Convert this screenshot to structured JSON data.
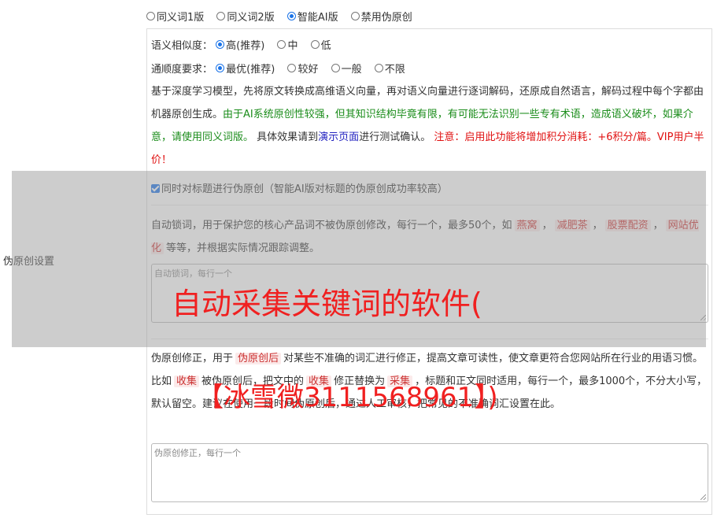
{
  "modes": [
    {
      "label": "同义词1版",
      "selected": false
    },
    {
      "label": "同义词2版",
      "selected": false
    },
    {
      "label": "智能AI版",
      "selected": true
    },
    {
      "label": "禁用伪原创",
      "selected": false
    }
  ],
  "similarity": {
    "label": "语义相似度：",
    "options": [
      "高(推荐)",
      "中",
      "低"
    ]
  },
  "fluency": {
    "label": "通顺度要求：",
    "options": [
      "最优(推荐)",
      "较好",
      "一般",
      "不限"
    ]
  },
  "desc": {
    "p1": "基于深度学习模型，先将原文转换成高维语义向量，再对语义向量进行逐词解码，还原成自然语言，解码过程中每个字都由机器原创生成。",
    "p2_green": "由于AI系统原创性较强，但其知识结构毕竟有限，有可能无法识别一些专有术语，造成语义破坏，如果介意，请使用同义词版。",
    "p3a": "具体效果请到",
    "p3_link": "演示页面",
    "p3b": "进行测试确认。",
    "p4_red": "注意：启用此功能将增加积分消耗：+6积分/篇。VIP用户半价！"
  },
  "section_label": "伪原创设置",
  "title_check": "同时对标题进行伪原创（智能AI版对标题的伪原创成功率较高）",
  "lock": {
    "text1": "自动锁词，用于保护您的核心产品词不被伪原创修改，每行一个，最多50个，如",
    "chips": [
      "燕窝",
      "减肥茶",
      "股票配资",
      "网站优化"
    ],
    "sep": "，",
    "text2": "等等，并根据实际情况跟踪调整。",
    "placeholder": "自动锁词，每行一个"
  },
  "correct": {
    "text1": "伪原创修正，用于",
    "chip": "伪原创后",
    "text2": "对某些不准确的词汇进行修正，提高文章可读性，使文章更符合您网站所在行业的用语习惯。比如",
    "chip2": "收集",
    "text3": "被伪原创后，把文中的",
    "chip3": "收集",
    "text4": "修正替换为",
    "chip4": "采集",
    "text5": "，标题和正文同时适用，每行一个，最多1000个，不分大小写，默认留空。建议在使用一段时间伪原创后，通过人工审核，把常见的不准确词汇设置在此。",
    "placeholder": "伪原创修正，每行一个"
  },
  "watermark1": "自动采集关键词的软件(",
  "watermark2": "【冰雪微3111568961】)",
  "colors": {
    "accent": "#1a73e8",
    "green": "#1a8c1a",
    "red": "#e01010",
    "link": "#1f1fbf"
  }
}
